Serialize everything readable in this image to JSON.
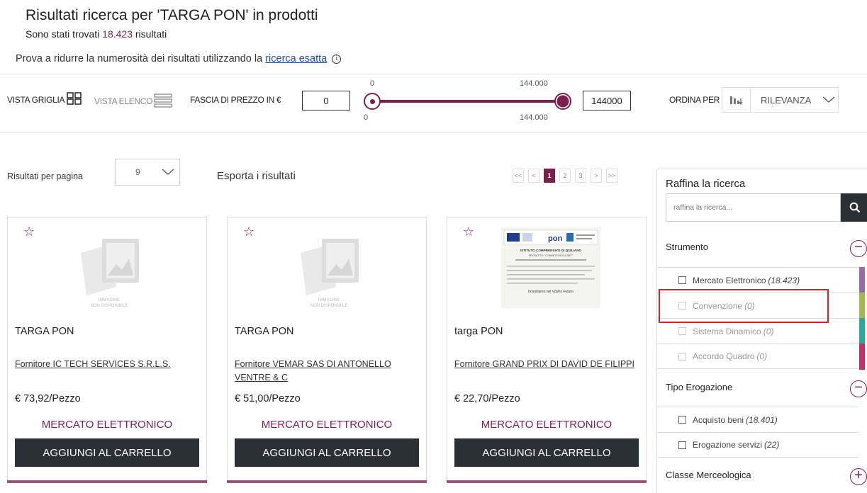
{
  "header": {
    "title": "Risultati ricerca per 'TARGA PON' in prodotti",
    "subtitle_prefix": "Sono stati trovati",
    "subtitle_count": "18.423",
    "subtitle_suffix": "risultati",
    "hint_prefix": "Prova a ridurre la numerosità dei risultati utilizzando la",
    "hint_link": "ricerca esatta",
    "info_icon": "i"
  },
  "toolbar": {
    "vista_griglia": "VISTA GRIGLIA",
    "vista_elenco": "VISTA ELENCO",
    "fascia_label": "FASCIA DI PREZZO IN €",
    "price_min": "0",
    "price_max": "144000",
    "slider_min_top": "0",
    "slider_min_bottom": "0",
    "slider_max_top": "144.000",
    "slider_max_bottom": "144.000",
    "ordina_label": "ORDINA PER",
    "sort_value": "RILEVANZA"
  },
  "results": {
    "rpp_label": "Risultati per pagina",
    "rpp_value": "9",
    "esporta": "Esporta i risultati",
    "pager": [
      "<<",
      "<",
      "1",
      "2",
      "3",
      ">",
      ">>"
    ],
    "active_page": "1"
  },
  "cards": [
    {
      "name": "TARGA PON",
      "supplier": "Fornitore IC TECH SERVICES S.R.L.S.",
      "price": "€ 73,92/Pezzo",
      "category": "MERCATO ELETTRONICO",
      "button": "AGGIUNGI AL CARRELLO",
      "placeholder_line1": "IMMAGINE",
      "placeholder_line2": "NON DISPONIBILE"
    },
    {
      "name": "TARGA PON",
      "supplier": "Fornitore VEMAR SAS DI ANTONELLO VENTRE & C",
      "price": "€ 51,00/Pezzo",
      "category": "MERCATO ELETTRONICO",
      "button": "AGGIUNGI AL CARRELLO",
      "placeholder_line1": "IMMAGINE",
      "placeholder_line2": "NON DISPONIBILE"
    },
    {
      "name": "targa PON",
      "supplier": "Fornitore GRAND PRIX DI DAVID DE FILIPPI",
      "price": "€ 22,70/Pezzo",
      "category": "MERCATO ELETTRONICO",
      "button": "AGGIUNGI AL CARRELLO",
      "plaque_line1": "ISTITUTO COMPRENSIVO DI QUILIANO",
      "plaque_line2": "PROGETTO: \"CONNETTIVITÀ A 360°\"",
      "plaque_footer": "Investiamo nel Vostro Futuro"
    }
  ],
  "sidebar": {
    "title": "Raffina la ricerca",
    "search_placeholder": "raffina la ricerca...",
    "facets": [
      {
        "title": "Strumento",
        "toggle": "−"
      },
      {
        "title": "Tipo Erogazione",
        "toggle": "−"
      },
      {
        "title": "Classe Merceologica",
        "toggle": "+"
      }
    ],
    "strumento_options": [
      {
        "label": "Mercato Elettronico",
        "count": "(18.423)",
        "color": "#9b6aa8"
      },
      {
        "label": "Convenzione",
        "count": "(0)",
        "color": "#a8b84a"
      },
      {
        "label": "Sistema Dinamico",
        "count": "(0)",
        "color": "#2aa8a0"
      },
      {
        "label": "Accordo Quadro",
        "count": "(0)",
        "color": "#c0306a"
      }
    ],
    "erogazione_options": [
      {
        "label": "Acquisto beni",
        "count": "(18.401)"
      },
      {
        "label": "Erogazione servizi",
        "count": "(22)"
      }
    ]
  },
  "colors": {
    "accent": "#7b1f4f",
    "button": "#2b2f36",
    "highlight": "#e02020"
  }
}
